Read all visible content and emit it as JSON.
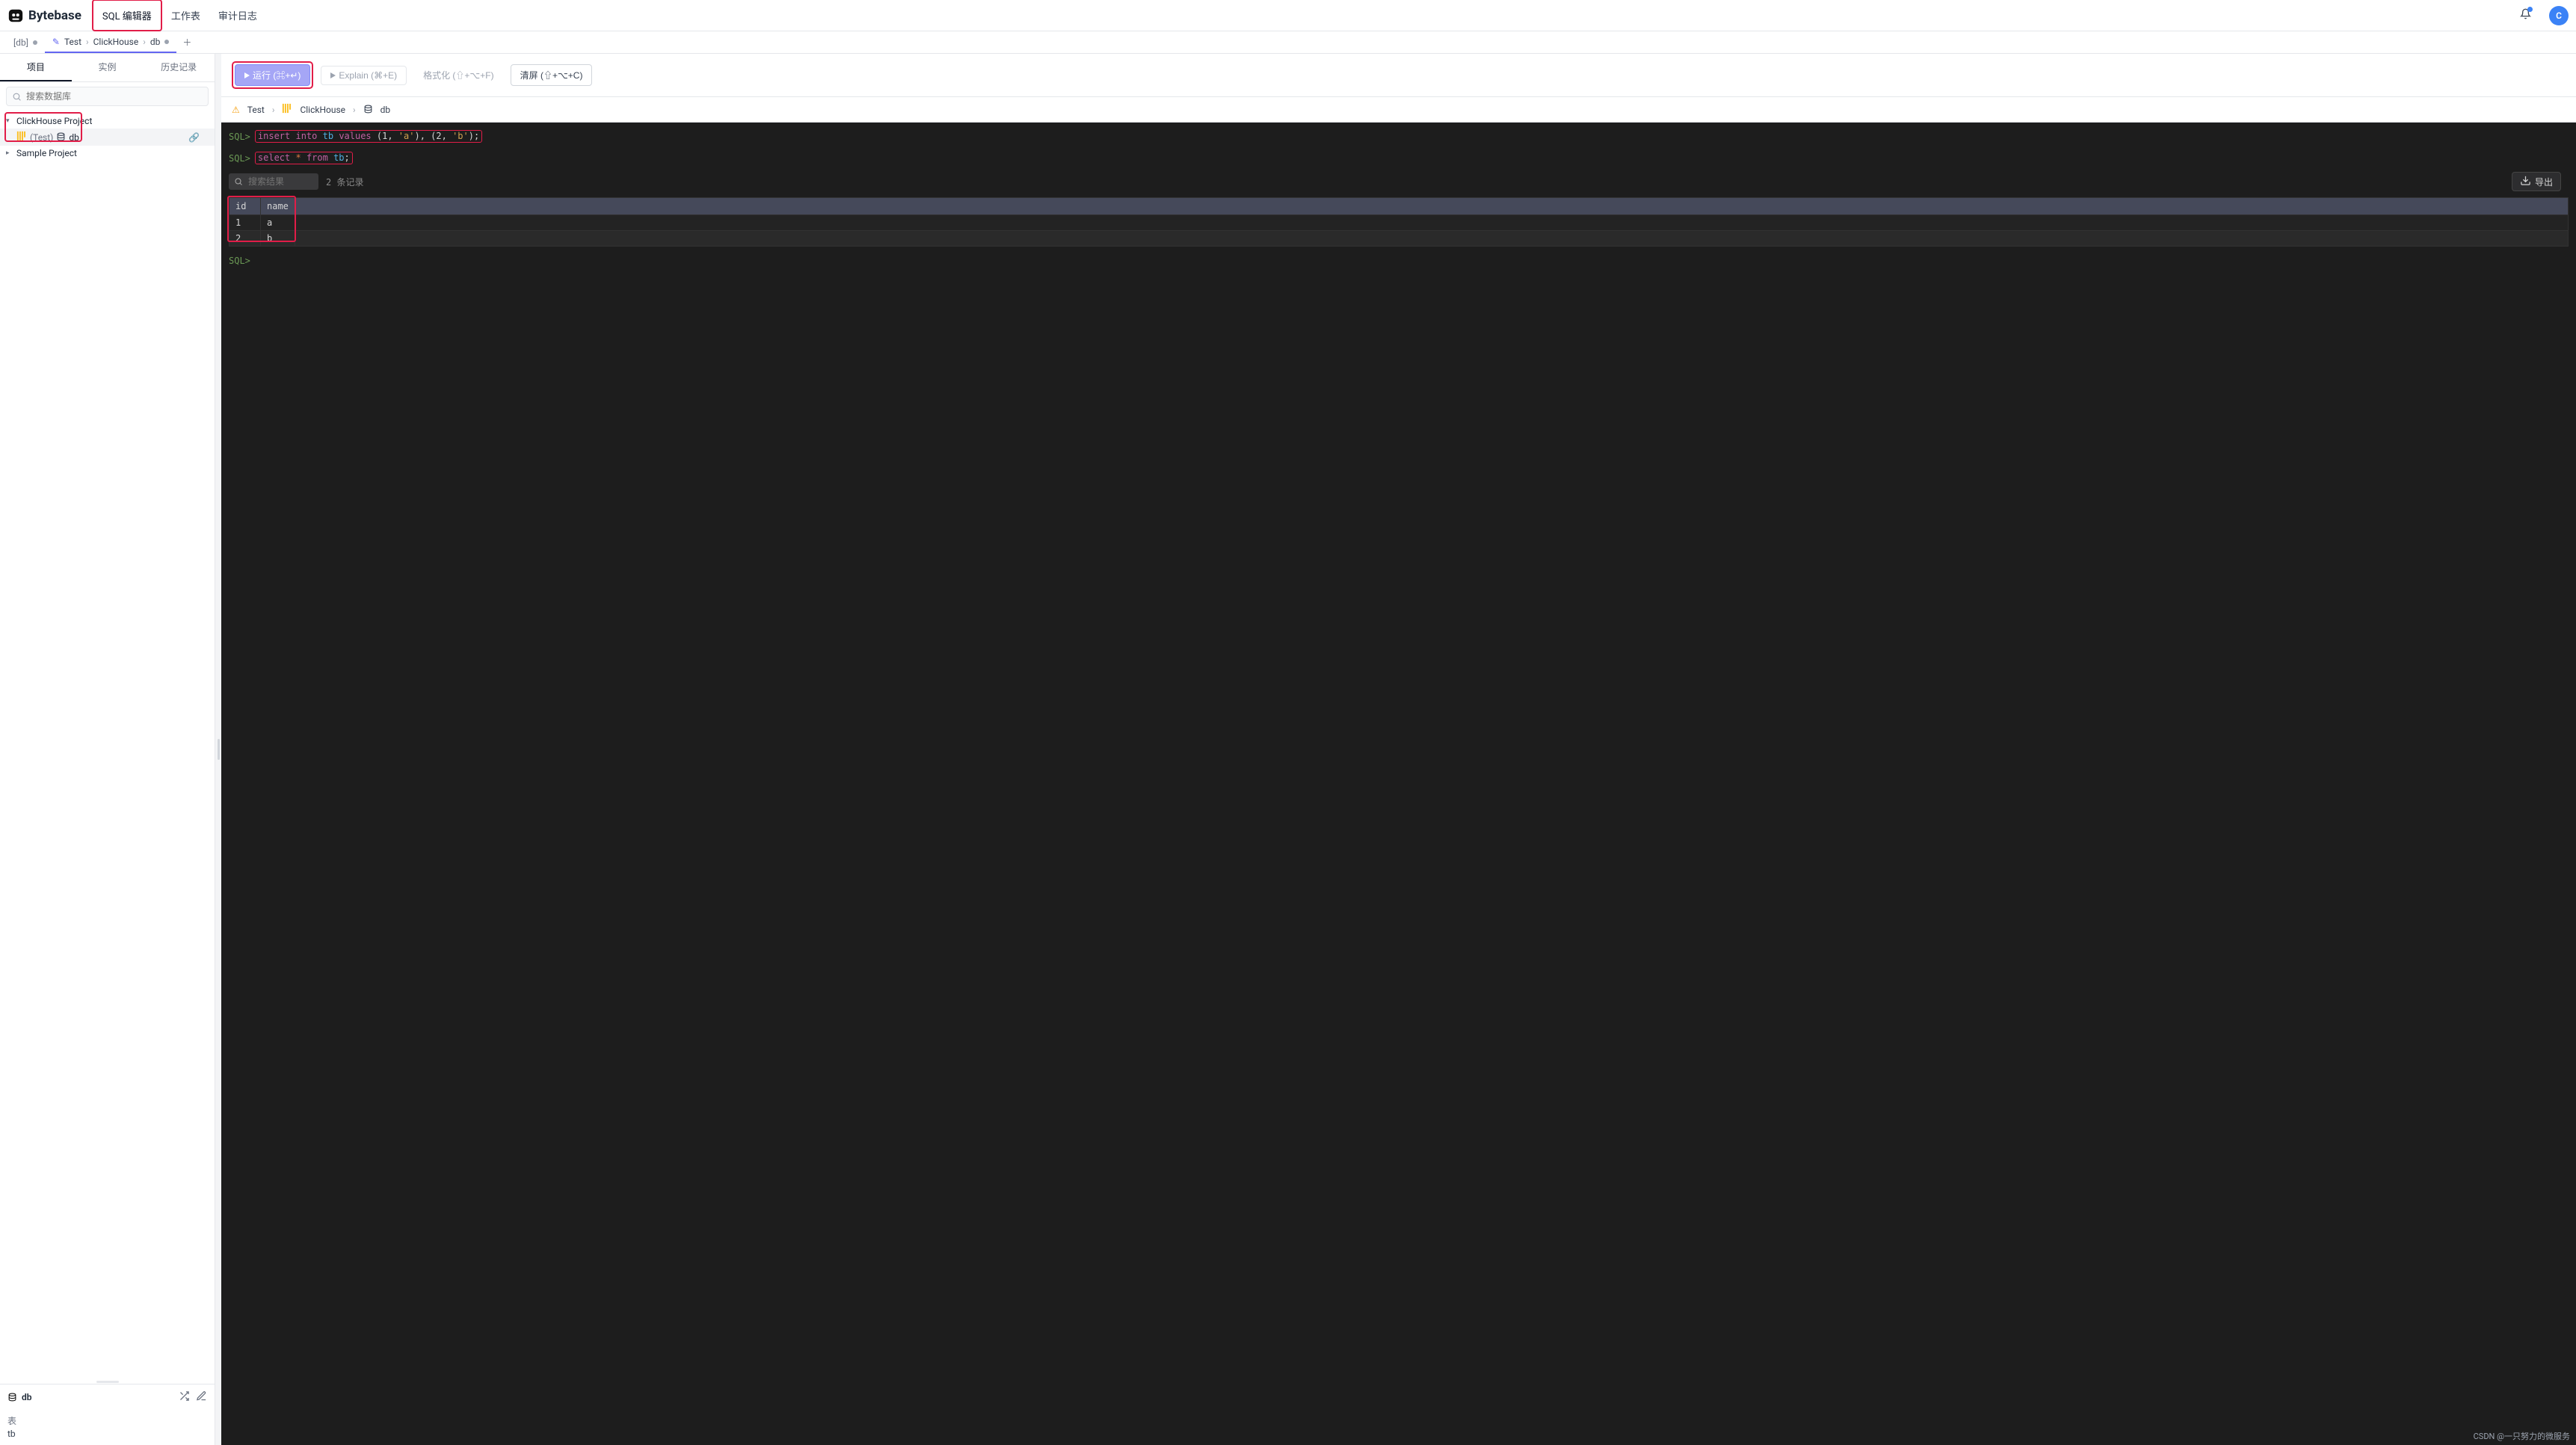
{
  "header": {
    "brand": "Bytebase",
    "nav": {
      "sql_editor": "SQL 编辑器",
      "worksheet": "工作表",
      "audit": "审计日志"
    },
    "avatar_initial": "C"
  },
  "tabbar": {
    "left_label": "[db]",
    "breadcrumb": [
      "Test",
      "ClickHouse",
      "db"
    ]
  },
  "sidebar": {
    "tabs": {
      "project": "项目",
      "instance": "实例",
      "history": "历史记录"
    },
    "search_placeholder": "搜索数据库",
    "tree": {
      "project1": "ClickHouse Project",
      "db_env": "(Test)",
      "db_name": "db",
      "project2": "Sample Project"
    },
    "bottom": {
      "db": "db",
      "tables_label": "表",
      "table1": "tb"
    }
  },
  "toolbar": {
    "run": "运行 (⌘+↵)",
    "explain": "Explain (⌘+E)",
    "format": "格式化 (⇧+⌥+F)",
    "clear": "清屏 (⇧+⌥+C)"
  },
  "editor_breadcrumb": {
    "a": "Test",
    "b": "ClickHouse",
    "c": "db"
  },
  "console": {
    "prompt": "SQL>",
    "stmt1": {
      "kw1": "insert into",
      "id1": "tb",
      "kw2": "values",
      "rest_a": " (1, ",
      "str1": "'a'",
      "rest_b": "), (2, ",
      "str2": "'b'",
      "rest_c": ");"
    },
    "stmt2": {
      "kw1": "select",
      "op1": " * ",
      "kw2": "from",
      "id1": " tb",
      "semi": ";"
    },
    "result_search_placeholder": "搜索结果",
    "result_count": "2 条记录",
    "export": "导出",
    "columns": [
      "id",
      "name"
    ],
    "rows": [
      {
        "id": "1",
        "name": "a"
      },
      {
        "id": "2",
        "name": "b"
      }
    ]
  },
  "chart_data": {
    "type": "table",
    "title": "select * from tb",
    "columns": [
      "id",
      "name"
    ],
    "rows": [
      [
        1,
        "a"
      ],
      [
        2,
        "b"
      ]
    ]
  },
  "watermark": "CSDN @一只努力的微服务"
}
